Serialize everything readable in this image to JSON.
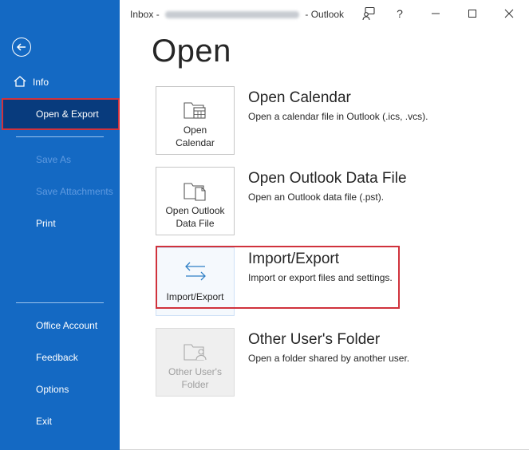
{
  "window": {
    "title_prefix": "Inbox - ",
    "title_suffix": " - Outlook",
    "help_label": "?"
  },
  "sidebar": {
    "items": [
      {
        "label": "Info"
      },
      {
        "label": "Open & Export"
      },
      {
        "label": "Save As"
      },
      {
        "label": "Save Attachments"
      },
      {
        "label": "Print"
      },
      {
        "label": "Office Account"
      },
      {
        "label": "Feedback"
      },
      {
        "label": "Options"
      },
      {
        "label": "Exit"
      }
    ]
  },
  "main": {
    "heading": "Open",
    "options": [
      {
        "tile_label": "Open Calendar",
        "title": "Open Calendar",
        "description": "Open a calendar file in Outlook (.ics, .vcs)."
      },
      {
        "tile_label": "Open Outlook Data File",
        "title": "Open Outlook Data File",
        "description": "Open an Outlook data file (.pst)."
      },
      {
        "tile_label": "Import/Export",
        "title": "Import/Export",
        "description": "Import or export files and settings."
      },
      {
        "tile_label": "Other User's Folder",
        "title": "Other User's Folder",
        "description": "Open a folder shared by another user."
      }
    ]
  },
  "icons": {
    "back": "back-arrow-icon",
    "info": "home-icon",
    "calendar": "folder-calendar-icon",
    "datafile": "folder-file-icon",
    "importexport": "import-export-arrows-icon",
    "otheruser": "folder-user-icon"
  },
  "colors": {
    "sidebar_bg": "#1469c3",
    "selected_bg": "#083b7d",
    "highlight_red": "#d0323c"
  }
}
